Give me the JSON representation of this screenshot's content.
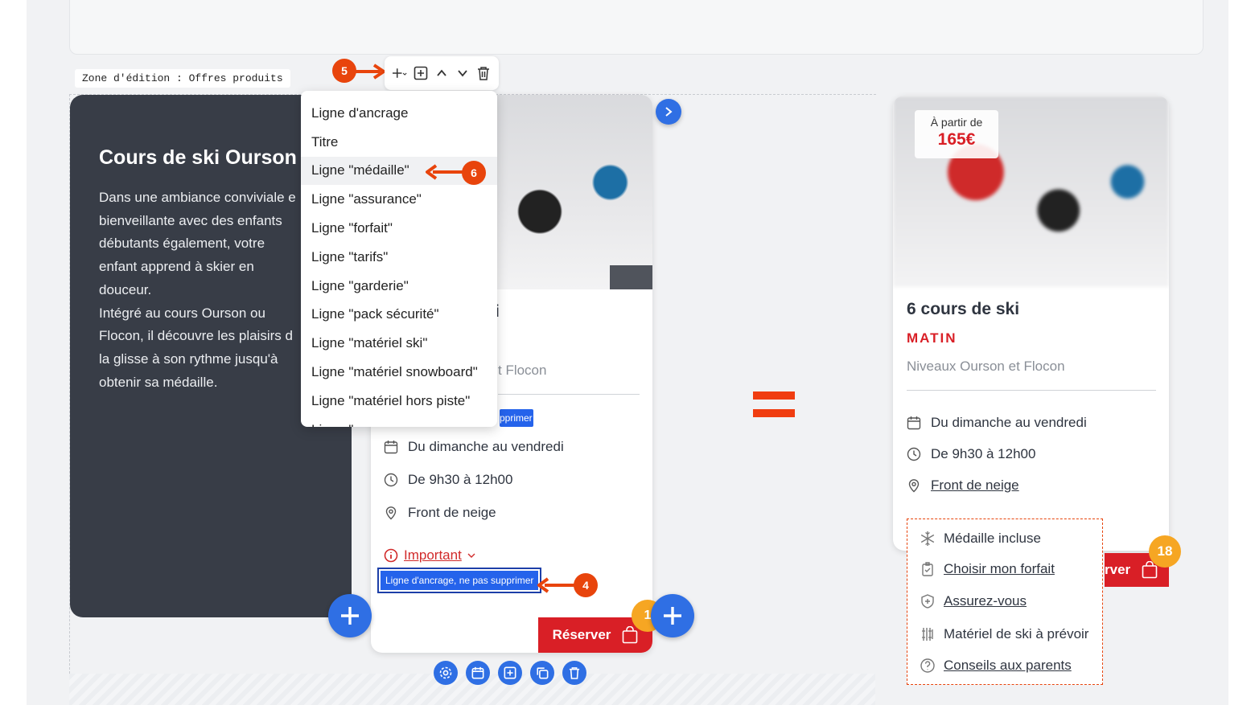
{
  "zone_label": "Zone d'édition : Offres produits",
  "dark_card": {
    "title": "Cours de ski Ourson",
    "body_lines": [
      "Dans une ambiance conviviale e",
      "bienveillante avec des enfants",
      "débutants également, votre",
      "enfant apprend à skier en",
      "douceur.",
      "Intégré au cours Ourson ou",
      "Flocon, il découvre les plaisirs d",
      "la glisse à son rythme jusqu'à",
      "obtenir sa médaille."
    ]
  },
  "dropdown": {
    "items": [
      "Ligne d'ancrage",
      "Titre",
      "Ligne \"médaille\"",
      "Ligne \"assurance\"",
      "Ligne \"forfait\"",
      "Ligne \"tarifs\"",
      "Ligne \"garderie\"",
      "Ligne \"pack sécurité\"",
      "Ligne \"matériel ski\"",
      "Ligne \"matériel snowboard\"",
      "Ligne \"matériel hors piste\"",
      "Ligne \"..."
    ],
    "selected_index": 2
  },
  "mid_card": {
    "title_fragment": "i",
    "subtitle_fragment": "t Flocon",
    "blue_tag_fragment": "pprimer",
    "rows": [
      "Du dimanche au vendredi",
      "De 9h30 à 12h00",
      "Front de neige"
    ],
    "important_label": "Important",
    "anchor_tag": "Ligne d'ancrage, ne pas supprimer",
    "reserve_label": "Réserver",
    "badge_count": "1"
  },
  "right_card": {
    "price_prefix": "À partir de",
    "price": "165€",
    "title": "6 cours de ski",
    "period": "MATIN",
    "subtitle": "Niveaux Ourson et Flocon",
    "rows": [
      "Du dimanche au vendredi",
      "De 9h30 à 12h00",
      "Front de neige"
    ],
    "extras": [
      "Médaille incluse",
      "Choisir mon forfait",
      "Assurez-vous",
      "Matériel de ski à prévoir",
      "Conseils aux parents"
    ],
    "reserve_fragment": "rver",
    "badge_count": "18"
  },
  "steps": {
    "toolbar": "5",
    "menu": "6",
    "anchor": "4"
  },
  "colors": {
    "accent_blue": "#2f6fe4",
    "brand_red": "#d91f26",
    "annotation_orange": "#e8440c",
    "badge_orange": "#f6a623"
  }
}
